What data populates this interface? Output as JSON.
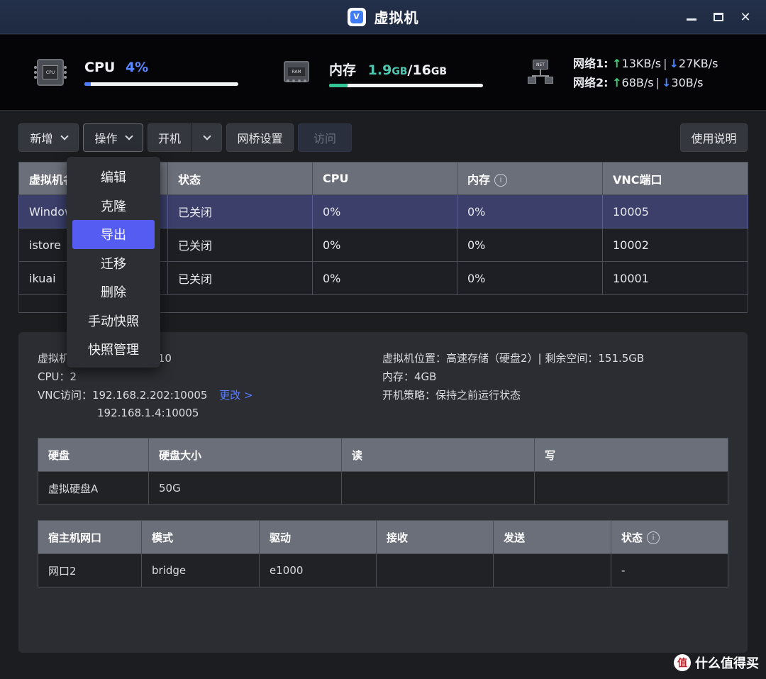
{
  "window": {
    "title": "虚拟机",
    "logo_letter": "V"
  },
  "stats": {
    "cpu": {
      "chip_label": "CPU",
      "label": "CPU",
      "value": "4%",
      "usage_fraction": 0.04
    },
    "memory": {
      "chip_label": "RAM",
      "label": "内存",
      "used": "1.9",
      "used_unit": "GB",
      "sep": "/",
      "total": "16",
      "total_unit": "GB",
      "usage_fraction": 0.12
    },
    "network": {
      "chip_label": "NET",
      "lines": [
        {
          "label": "网络1:",
          "up_arrow": "↑",
          "up": "13KB/s",
          "sep": "|",
          "down_arrow": "↓",
          "down": "27KB/s"
        },
        {
          "label": "网络2:",
          "up_arrow": "↑",
          "up": "68B/s",
          "sep": "|",
          "down_arrow": "↓",
          "down": "30B/s"
        }
      ]
    }
  },
  "toolbar": {
    "add": "新增",
    "operate": "操作",
    "power_on": "开机",
    "bridge_settings": "网桥设置",
    "visit": "访问",
    "help": "使用说明"
  },
  "vm_table": {
    "headers": [
      "虚拟机名",
      "状态",
      "CPU",
      "内存",
      "VNC端口"
    ],
    "rows": [
      {
        "name": "Windows",
        "status": "已关闭",
        "cpu": "0%",
        "memory": "0%",
        "vnc": "10005"
      },
      {
        "name": "istore",
        "status": "已关闭",
        "cpu": "0%",
        "memory": "0%",
        "vnc": "10002"
      },
      {
        "name": "ikuai",
        "status": "已关闭",
        "cpu": "0%",
        "memory": "0%",
        "vnc": "10001"
      }
    ]
  },
  "operate_menu": {
    "items": [
      "编辑",
      "克隆",
      "导出",
      "迁移",
      "删除",
      "手动快照",
      "快照管理"
    ],
    "highlighted": "导出"
  },
  "details": {
    "left": {
      "vm_label_partial": "虚拟机",
      "vm_value_partial": "10",
      "cpu": "CPU：2",
      "vnc_label": "VNC访问：",
      "vnc_addr1": "192.168.2.202:10005",
      "vnc_change": "更改 >",
      "vnc_addr2": "192.168.1.4:10005"
    },
    "right": {
      "location": "虚拟机位置：高速存储（硬盘2）| 剩余空间：151.5GB",
      "memory": "内存：4GB",
      "boot_policy": "开机策略：保持之前运行状态"
    }
  },
  "disk_table": {
    "headers": [
      "硬盘",
      "硬盘大小",
      "读",
      "写"
    ],
    "rows": [
      {
        "disk": "虚拟硬盘A",
        "size": "50G",
        "read": "",
        "write": ""
      }
    ]
  },
  "nic_table": {
    "headers": [
      "宿主机网口",
      "模式",
      "驱动",
      "接收",
      "发送",
      "状态"
    ],
    "rows": [
      {
        "port": "网口2",
        "mode": "bridge",
        "driver": "e1000",
        "rx": "",
        "tx": "",
        "status": "-"
      }
    ]
  },
  "watermark": {
    "logo": "值",
    "text": "什么值得买"
  }
}
